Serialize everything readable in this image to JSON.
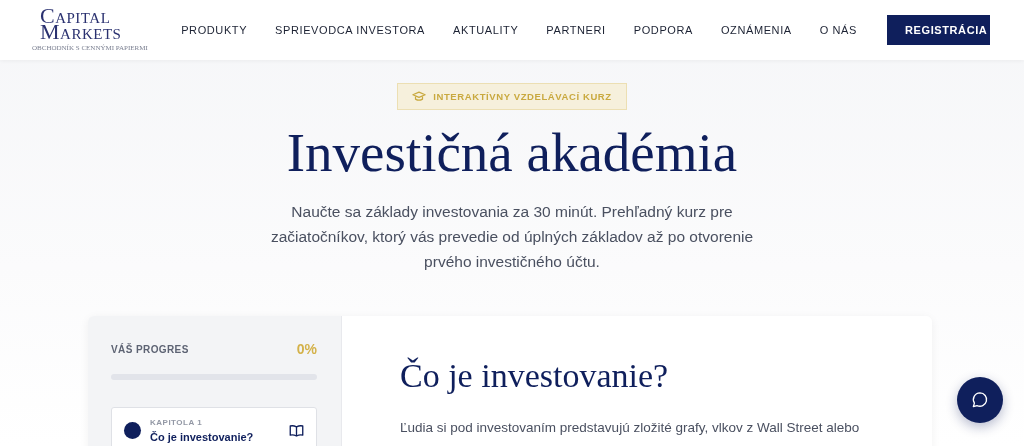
{
  "header": {
    "logo": {
      "lines": [
        "CAPITAL",
        "MARKETS"
      ],
      "tagline": "OBCHODNÍK S CENNÝMI PAPIERMI"
    },
    "nav": [
      {
        "label": "PRODUKTY"
      },
      {
        "label": "SPRIEVODCA INVESTORA"
      },
      {
        "label": "AKTUALITY"
      },
      {
        "label": "PARTNERI"
      },
      {
        "label": "PODPORA"
      },
      {
        "label": "OZNÁMENIA"
      },
      {
        "label": "O NÁS"
      }
    ],
    "cta": "REGISTRÁCIA"
  },
  "hero": {
    "badge": "INTERAKTÍVNY VZDELÁVACÍ KURZ",
    "title": "Investičná akadémia",
    "lead": "Naučte sa základy investovania za 30 minút. Prehľadný kurz pre začiatočníkov, ktorý vás prevedie od úplných základov až po otvorenie prvého investičného účtu."
  },
  "sidebar": {
    "progress_label": "VÁŠ PROGRES",
    "progress_value": "0%",
    "level": 0,
    "chapters": [
      {
        "number": "KAPITOLA 1",
        "title": "Čo je investovanie?",
        "selected": true
      }
    ]
  },
  "content": {
    "heading": "Čo je investovanie?",
    "paragraph": "Ľudia si pod investovaním predstavujú zložité grafy, vlkov z Wall Street alebo"
  }
}
